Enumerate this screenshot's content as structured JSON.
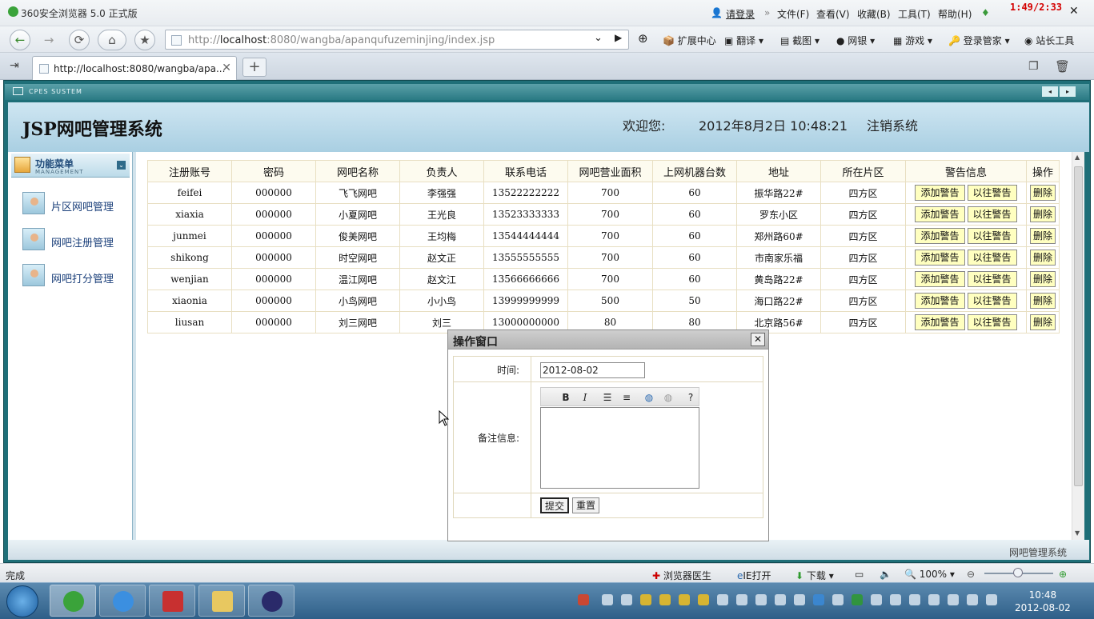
{
  "browser": {
    "title": "360安全浏览器 5.0 正式版",
    "login_link": "请登录",
    "menus": [
      "文件(F)",
      "查看(V)",
      "收藏(B)",
      "工具(T)",
      "帮助(H)"
    ],
    "url_prefix": "http://",
    "url_host": "localhost",
    "url_rest": ":8080/wangba/apanqufuzeminjing/index.jsp",
    "toolbar": [
      "扩展中心",
      "翻译",
      "截图",
      "网银",
      "游戏",
      "登录管家",
      "站长工具"
    ],
    "tab_title": "http://localhost:8080/wangba/apa...",
    "recording_time": "1:49/2:33"
  },
  "app": {
    "strip_label": "CPES SUSTEM",
    "system_title": "JSP网吧管理系统",
    "welcome": "欢迎您:",
    "datetime": "2012年8月2日  10:48:21",
    "logout": "注销系统",
    "footer": "网吧管理系统",
    "menu_title": "功能菜单",
    "menu_subtitle": "MANAGEMENT",
    "menu_items": [
      "片区网吧管理",
      "网吧注册管理",
      "网吧打分管理"
    ]
  },
  "table": {
    "headers": [
      "注册账号",
      "密码",
      "网吧名称",
      "负责人",
      "联系电话",
      "网吧营业面积",
      "上网机器台数",
      "地址",
      "所在片区",
      "警告信息",
      "操作"
    ],
    "add_label": "添加警告",
    "history_label": "以往警告",
    "delete_label": "删除",
    "rows": [
      [
        "feifei",
        "000000",
        "飞飞网吧",
        "李强强",
        "13522222222",
        "700",
        "60",
        "振华路22#",
        "四方区"
      ],
      [
        "xiaxia",
        "000000",
        "小夏网吧",
        "王光良",
        "13523333333",
        "700",
        "60",
        "罗东小区",
        "四方区"
      ],
      [
        "junmei",
        "000000",
        "俊美网吧",
        "王均梅",
        "13544444444",
        "700",
        "60",
        "郑州路60#",
        "四方区"
      ],
      [
        "shikong",
        "000000",
        "时空网吧",
        "赵文正",
        "13555555555",
        "700",
        "60",
        "市南家乐福",
        "四方区"
      ],
      [
        "wenjian",
        "000000",
        "温江网吧",
        "赵文江",
        "13566666666",
        "700",
        "60",
        "黄岛路22#",
        "四方区"
      ],
      [
        "xiaonia",
        "000000",
        "小鸟网吧",
        "小小鸟",
        "13999999999",
        "500",
        "50",
        "海口路22#",
        "四方区"
      ],
      [
        "liusan",
        "000000",
        "刘三网吧",
        "刘三",
        "13000000000",
        "80",
        "80",
        "北京路56#",
        "四方区"
      ]
    ]
  },
  "dialog": {
    "title": "操作窗口",
    "time_label": "时间:",
    "time_value": "2012-08-02",
    "note_label": "备注信息:",
    "submit_label": "提交",
    "reset_label": "重置"
  },
  "status": {
    "left": "完成",
    "doctor": "浏览器医生",
    "ie_open": "IE打开",
    "download": "下载",
    "zoom": "100%"
  },
  "taskbar": {
    "time": "10:48",
    "date": "2012-08-02"
  }
}
